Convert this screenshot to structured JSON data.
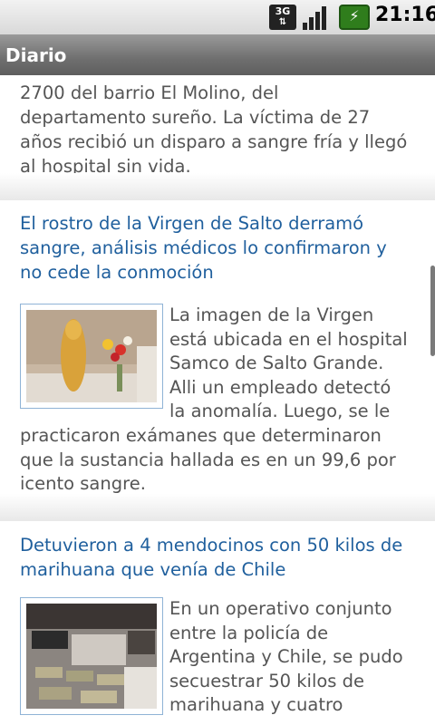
{
  "status_bar": {
    "network": "3G",
    "time": "21:16",
    "icons": [
      "3g-data-icon",
      "signal-icon",
      "battery-icon"
    ]
  },
  "title_bar": {
    "title": "Diario"
  },
  "partial_article": {
    "lines": [
      "2700 del barrio El Molino, del",
      "departamento sureño. La víctima de 27",
      "años recibió un disparo a sangre fría y llegó",
      "al hospital sin vida."
    ]
  },
  "articles": [
    {
      "headline_lines": [
        "El rostro de la Virgen de Salto derramó",
        "sangre, análisis médicos lo confirmaron y",
        "no cede la conmoción"
      ],
      "body_side_lines": [
        "La imagen de la Virgen",
        "está ubicada en el hospital",
        "Samco de Salto Grande.",
        "Alli un empleado detectó",
        "la anomalía. Luego, se le"
      ],
      "body_full_lines": [
        "practicaron exámanes que determinaron",
        "que la sustancia hallada es en un 99,6 por",
        "icento sangre."
      ]
    },
    {
      "headline_lines": [
        "Detuvieron a 4 mendocinos con 50 kilos de",
        "marihuana que venía de Chile"
      ],
      "body_side_lines": [
        "En un operativo conjunto",
        "entre la policía de",
        "Argentina y Chile, se pudo",
        "secuestrar 50 kilos de",
        "marihuana y cuatro"
      ],
      "body_full_lines": []
    }
  ],
  "colors": {
    "headline": "#1f5f9d",
    "body_text": "#555555",
    "title_bar": "#6f6f6f",
    "thumb_border": "#8fb3d6"
  }
}
